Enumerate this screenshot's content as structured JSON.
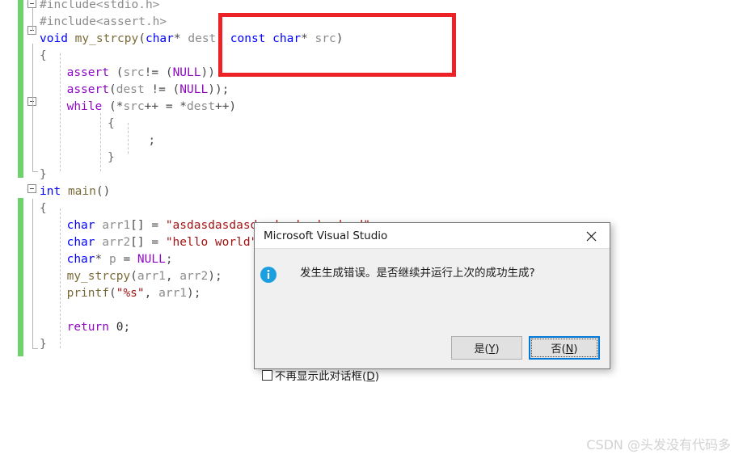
{
  "editor": {
    "name": "visual-studio-code-editor",
    "background": "#ffffff",
    "change_bar_color": "#6ed16e",
    "lines": [
      {
        "indent": 0,
        "tokens": [
          {
            "t": "#include<stdio.h>",
            "c": "pp"
          }
        ]
      },
      {
        "indent": 0,
        "tokens": [
          {
            "t": "#include<assert.h>",
            "c": "pp"
          }
        ]
      },
      {
        "indent": 0,
        "tokens": [
          {
            "t": "void",
            "c": "kw"
          },
          {
            "t": " ",
            "c": "punct"
          },
          {
            "t": "my_strcpy",
            "c": "fn"
          },
          {
            "t": "(",
            "c": "punct"
          },
          {
            "t": "char",
            "c": "kw"
          },
          {
            "t": "* ",
            "c": "punct"
          },
          {
            "t": "dest",
            "c": "id"
          },
          {
            "t": ", ",
            "c": "punct"
          },
          {
            "t": "const",
            "c": "kw"
          },
          {
            "t": " ",
            "c": "punct"
          },
          {
            "t": "char",
            "c": "kw"
          },
          {
            "t": "* ",
            "c": "punct"
          },
          {
            "t": "src",
            "c": "id"
          },
          {
            "t": ")",
            "c": "punct"
          }
        ]
      },
      {
        "indent": 0,
        "tokens": [
          {
            "t": "{",
            "c": "brace"
          }
        ]
      },
      {
        "indent": 2,
        "tokens": [
          {
            "t": "assert",
            "c": "macro"
          },
          {
            "t": " (",
            "c": "punct"
          },
          {
            "t": "src",
            "c": "id"
          },
          {
            "t": "!= (",
            "c": "punct"
          },
          {
            "t": "NULL",
            "c": "macro"
          },
          {
            "t": "))",
            "c": "punct"
          }
        ]
      },
      {
        "indent": 2,
        "tokens": [
          {
            "t": "assert",
            "c": "macro"
          },
          {
            "t": "(",
            "c": "punct"
          },
          {
            "t": "dest",
            "c": "id"
          },
          {
            "t": " != (",
            "c": "punct"
          },
          {
            "t": "NULL",
            "c": "macro"
          },
          {
            "t": "));",
            "c": "punct"
          }
        ]
      },
      {
        "indent": 2,
        "tokens": [
          {
            "t": "while",
            "c": "ctrl"
          },
          {
            "t": " (*",
            "c": "punct"
          },
          {
            "t": "src",
            "c": "id"
          },
          {
            "t": "++ = *",
            "c": "punct"
          },
          {
            "t": "dest",
            "c": "id"
          },
          {
            "t": "++)",
            "c": "punct"
          }
        ]
      },
      {
        "indent": 5,
        "tokens": [
          {
            "t": "{",
            "c": "brace"
          }
        ]
      },
      {
        "indent": 8,
        "tokens": [
          {
            "t": ";",
            "c": "punct"
          }
        ]
      },
      {
        "indent": 5,
        "tokens": [
          {
            "t": "}",
            "c": "brace"
          }
        ]
      },
      {
        "indent": 0,
        "tokens": [
          {
            "t": "}",
            "c": "brace"
          }
        ]
      },
      {
        "indent": 0,
        "tokens": [
          {
            "t": "int",
            "c": "kw"
          },
          {
            "t": " ",
            "c": "punct"
          },
          {
            "t": "main",
            "c": "fn"
          },
          {
            "t": "()",
            "c": "punct"
          }
        ]
      },
      {
        "indent": 0,
        "tokens": [
          {
            "t": "{",
            "c": "brace"
          }
        ]
      },
      {
        "indent": 2,
        "tokens": [
          {
            "t": "char",
            "c": "kw"
          },
          {
            "t": " ",
            "c": "punct"
          },
          {
            "t": "arr1",
            "c": "id"
          },
          {
            "t": "[] = ",
            "c": "punct"
          },
          {
            "t": "\"asdasdasdasdasdasdasdasdasd\"",
            "c": "str"
          }
        ]
      },
      {
        "indent": 2,
        "tokens": [
          {
            "t": "char",
            "c": "kw"
          },
          {
            "t": " ",
            "c": "punct"
          },
          {
            "t": "arr2",
            "c": "id"
          },
          {
            "t": "[] = ",
            "c": "punct"
          },
          {
            "t": "\"hello world\"",
            "c": "str"
          }
        ]
      },
      {
        "indent": 2,
        "tokens": [
          {
            "t": "char",
            "c": "kw"
          },
          {
            "t": "* ",
            "c": "punct"
          },
          {
            "t": "p",
            "c": "id"
          },
          {
            "t": " = ",
            "c": "punct"
          },
          {
            "t": "NULL",
            "c": "macro"
          },
          {
            "t": ";",
            "c": "punct"
          }
        ]
      },
      {
        "indent": 2,
        "tokens": [
          {
            "t": "my_strcpy",
            "c": "fn"
          },
          {
            "t": "(",
            "c": "punct"
          },
          {
            "t": "arr1",
            "c": "id"
          },
          {
            "t": ", ",
            "c": "punct"
          },
          {
            "t": "arr2",
            "c": "id"
          },
          {
            "t": ");",
            "c": "punct"
          }
        ]
      },
      {
        "indent": 2,
        "tokens": [
          {
            "t": "printf",
            "c": "fn"
          },
          {
            "t": "(",
            "c": "punct"
          },
          {
            "t": "\"%s\"",
            "c": "str"
          },
          {
            "t": ", ",
            "c": "punct"
          },
          {
            "t": "arr1",
            "c": "id"
          },
          {
            "t": ");",
            "c": "punct"
          }
        ]
      },
      {
        "indent": 0,
        "tokens": [
          {
            "t": "",
            "c": "punct"
          }
        ]
      },
      {
        "indent": 2,
        "tokens": [
          {
            "t": "return",
            "c": "macro"
          },
          {
            "t": " ",
            "c": "punct"
          },
          {
            "t": "0",
            "c": "num"
          },
          {
            "t": ";",
            "c": "punct"
          }
        ]
      },
      {
        "indent": 0,
        "tokens": [
          {
            "t": "}",
            "c": "brace"
          }
        ]
      }
    ]
  },
  "annotation": {
    "name": "red-highlight-box",
    "color": "#ec2227",
    "highlights_text": "const char* src"
  },
  "dialog": {
    "title": "Microsoft Visual Studio",
    "message": "发生生成错误。是否继续并运行上次的成功生成?",
    "icon": "info-icon",
    "close_label": "×",
    "buttons": [
      {
        "label": "是",
        "mnemonic": "Y",
        "focused": false
      },
      {
        "label": "否",
        "mnemonic": "N",
        "focused": true
      }
    ],
    "checkbox": {
      "label": "不再显示此对话框",
      "mnemonic": "D",
      "checked": false
    },
    "accent_color": "#0078d7",
    "info_icon_color": "#1c9fe0"
  },
  "watermark": {
    "text": "CSDN @头发没有代码多"
  }
}
